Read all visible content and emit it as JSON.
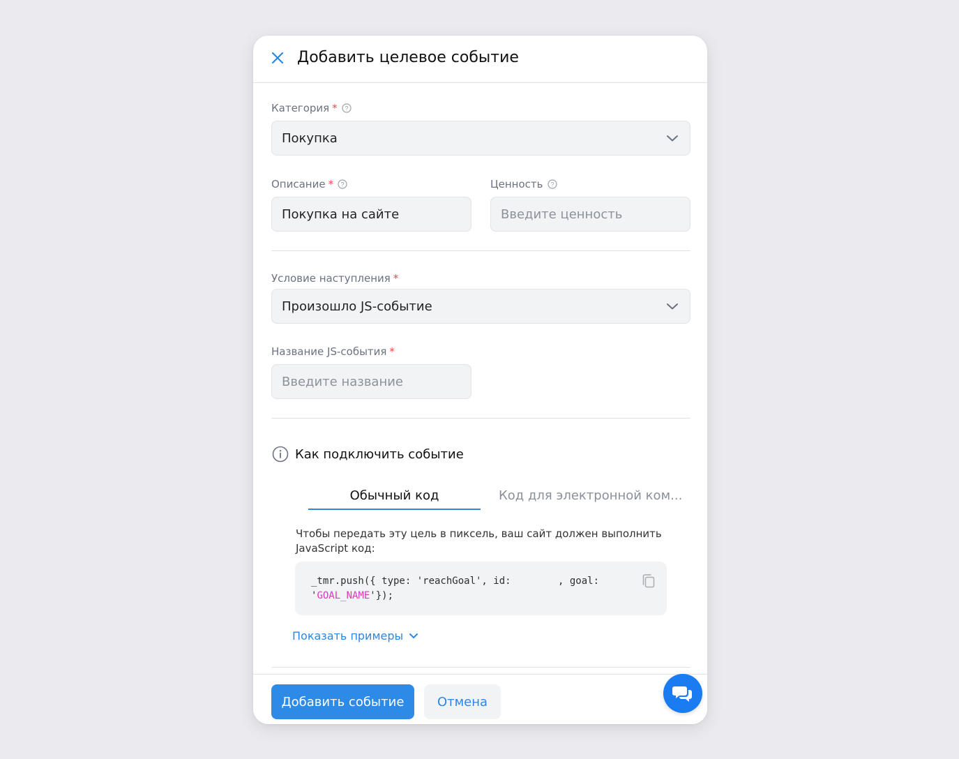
{
  "header": {
    "title": "Добавить целевое событие",
    "close_icon": "close-icon"
  },
  "category": {
    "label": "Категория",
    "required_mark": "*",
    "value": "Покупка"
  },
  "description": {
    "label": "Описание",
    "required_mark": "*",
    "value": "Покупка на сайте"
  },
  "value_field": {
    "label": "Ценность",
    "placeholder": "Введите ценность"
  },
  "condition": {
    "label": "Условие наступления",
    "required_mark": "*",
    "value": "Произошло JS-событие"
  },
  "js_event_name": {
    "label": "Название JS-события",
    "required_mark": "*",
    "placeholder": "Введите название"
  },
  "howto": {
    "title": "Как подключить событие",
    "tabs": [
      {
        "label": "Обычный код",
        "active": true
      },
      {
        "label": "Код для электронной ком...",
        "active": false
      }
    ],
    "instructions": "Чтобы передать эту цель в пиксель, ваш сайт должен выполнить JavaScript код:",
    "code_line1": "_tmr.push({ type: 'reachGoal', id:        , goal:",
    "code_quote_open": "'",
    "code_goal_name": "GOAL_NAME",
    "code_line2_end": "'});",
    "show_examples": "Показать примеры"
  },
  "footer": {
    "primary_label": "Добавить событие",
    "cancel_label": "Отмена"
  },
  "colors": {
    "accent": "#2d8ae6",
    "required": "#e84a4a",
    "code_highlight": "#d83ab8",
    "chat_button": "#1a7cf0"
  }
}
